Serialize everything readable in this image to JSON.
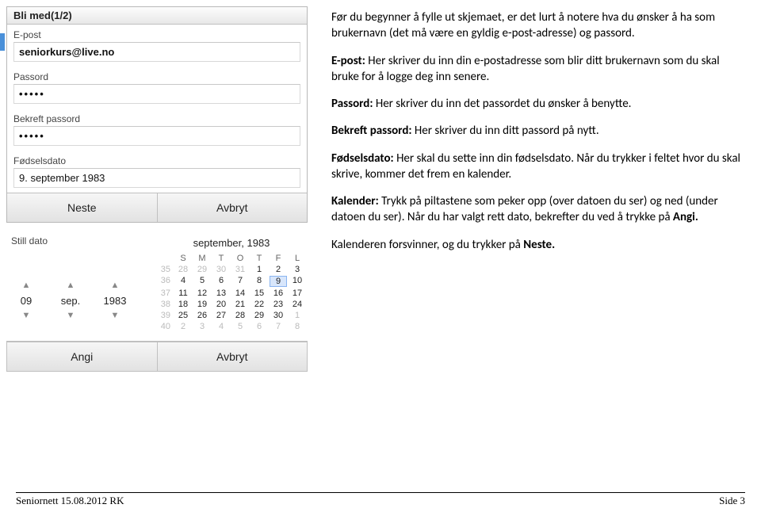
{
  "form": {
    "title": "Bli med(1/2)",
    "email_label": "E-post",
    "email_value": "seniorkurs@live.no",
    "password_label": "Passord",
    "password_value": "•••••",
    "confirm_label": "Bekreft passord",
    "confirm_value": "•••••",
    "birthdate_label": "Fødselsdato",
    "birthdate_value": "9. september 1983",
    "next_btn": "Neste",
    "cancel_btn": "Avbryt"
  },
  "datepicker": {
    "title": "Still dato",
    "day": "09",
    "month_short": "sep.",
    "year": "1983",
    "cal_month": "september, 1983",
    "weekdays": [
      "S",
      "M",
      "T",
      "O",
      "T",
      "F",
      "L"
    ],
    "weeks": [
      {
        "wk": "35",
        "days": [
          "28",
          "29",
          "30",
          "31",
          "1",
          "2",
          "3"
        ],
        "dim": [
          0,
          1,
          2,
          3
        ]
      },
      {
        "wk": "36",
        "days": [
          "4",
          "5",
          "6",
          "7",
          "8",
          "9",
          "10"
        ],
        "dim": [],
        "sel": 5
      },
      {
        "wk": "37",
        "days": [
          "11",
          "12",
          "13",
          "14",
          "15",
          "16",
          "17"
        ],
        "dim": []
      },
      {
        "wk": "38",
        "days": [
          "18",
          "19",
          "20",
          "21",
          "22",
          "23",
          "24"
        ],
        "dim": []
      },
      {
        "wk": "39",
        "days": [
          "25",
          "26",
          "27",
          "28",
          "29",
          "30",
          "1"
        ],
        "dim": [
          6
        ]
      },
      {
        "wk": "40",
        "days": [
          "2",
          "3",
          "4",
          "5",
          "6",
          "7",
          "8"
        ],
        "dim": [
          0,
          1,
          2,
          3,
          4,
          5,
          6
        ]
      }
    ],
    "set_btn": "Angi",
    "cancel_btn": "Avbryt"
  },
  "instructions": {
    "p1": "Før du begynner å fylle ut skjemaet, er det lurt å notere hva du ønsker å ha som brukernavn (det må være en gyldig e-post-adresse) og passord.",
    "p2a": "E-post:",
    "p2b": " Her skriver du inn din e-postadresse som blir ditt brukernavn som du skal bruke for å logge deg inn senere.",
    "p3a": "Passord:",
    "p3b": " Her skriver du inn det passordet du ønsker å benytte.",
    "p4a": "Bekreft passord:",
    "p4b": " Her skriver du inn ditt passord på nytt.",
    "p5a": "Fødselsdato:",
    "p5b": " Her skal du sette inn din fødselsdato. Når du trykker i feltet hvor du skal skrive, kommer det frem en kalender.",
    "p6a": "Kalender:",
    "p6b": " Trykk på piltastene som peker opp (over datoen du ser) og ned (under datoen du ser). Når du har valgt rett dato, bekrefter du ved å trykke på ",
    "p6c": "Angi.",
    "p7a": "Kalenderen forsvinner, og du trykker på ",
    "p7b": "Neste."
  },
  "footer": {
    "left": "Seniornett 15.08.2012 RK",
    "right": "Side 3"
  }
}
